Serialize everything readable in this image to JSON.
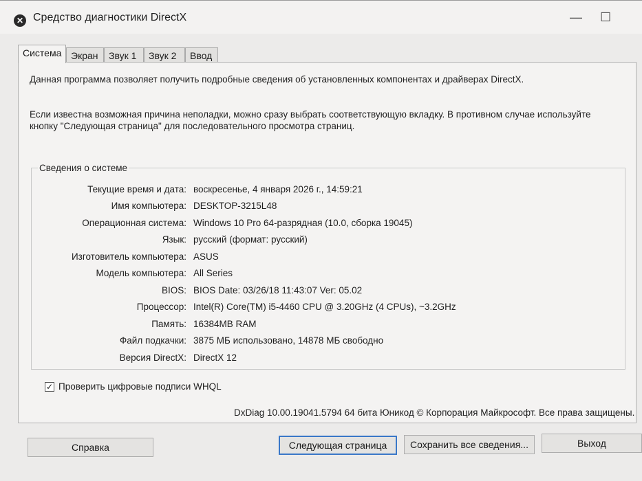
{
  "window": {
    "title": "Средство диагностики DirectX",
    "icon": "directx-icon",
    "controls": {
      "minimize": "—",
      "maximize": "☐"
    }
  },
  "tabs": [
    {
      "label": "Система",
      "active": true
    },
    {
      "label": "Экран",
      "active": false
    },
    {
      "label": "Звук 1",
      "active": false
    },
    {
      "label": "Звук 2",
      "active": false
    },
    {
      "label": "Ввод",
      "active": false
    }
  ],
  "intro": {
    "line1": "Данная программа позволяет получить подробные сведения об установленных компонентах и драйверах DirectX.",
    "line2": "Если известна возможная причина неполадки, можно сразу выбрать соответствующую вкладку. В противном случае используйте кнопку \"Следующая страница\" для последовательного просмотра страниц."
  },
  "system_info": {
    "title": "Сведения о системе",
    "rows": [
      {
        "label": "Текущие время и дата:",
        "value": "воскресенье, 4 января 2026 г., 14:59:21"
      },
      {
        "label": "Имя компьютера:",
        "value": "DESKTOP-3215L48"
      },
      {
        "label": "Операционная система:",
        "value": "Windows 10 Pro 64-разрядная (10.0, сборка 19045)"
      },
      {
        "label": "Язык:",
        "value": "русский (формат: русский)"
      },
      {
        "label": "Изготовитель компьютера:",
        "value": "ASUS"
      },
      {
        "label": "Модель компьютера:",
        "value": "All Series"
      },
      {
        "label": "BIOS:",
        "value": "BIOS Date: 03/26/18 11:43:07 Ver: 05.02"
      },
      {
        "label": "Процессор:",
        "value": "Intel(R) Core(TM) i5-4460  CPU @ 3.20GHz (4 CPUs), ~3.2GHz"
      },
      {
        "label": "Память:",
        "value": "16384MB RAM"
      },
      {
        "label": "Файл подкачки:",
        "value": "3875 МБ использовано, 14878 МБ свободно"
      },
      {
        "label": "Версия DirectX:",
        "value": "DirectX 12"
      }
    ]
  },
  "whql": {
    "label": "Проверить цифровые подписи WHQL",
    "checked": true,
    "mark": "✓"
  },
  "copyright": "DxDiag 10.00.19041.5794 64 бита Юникод © Корпорация Майкрософт. Все права защищены.",
  "buttons": {
    "help": "Справка",
    "next_page": "Следующая страница",
    "save_all": "Сохранить все сведения...",
    "exit": "Выход"
  }
}
